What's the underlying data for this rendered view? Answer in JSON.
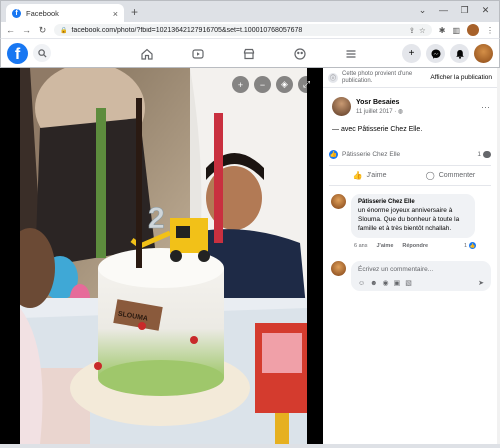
{
  "browser": {
    "tab_title": "Facebook",
    "tab_close": "×",
    "new_tab": "+",
    "favicon_letter": "f",
    "url": "facebook.com/photo/?fbid=10213642127916705&set=t.100010768057678",
    "window_controls": [
      "⌄",
      "—",
      "❐",
      "✕"
    ]
  },
  "fb_header": {
    "logo_letter": "f",
    "nav_icons": [
      "home-icon",
      "watch-icon",
      "marketplace-icon",
      "groups-icon",
      "menu-icon"
    ]
  },
  "notice": {
    "text": "Cette photo provient d'une publication.",
    "button_label": "Afficher la publication"
  },
  "post": {
    "author": "Yosr Besaies",
    "date": "11 juillet 2017 · ",
    "with_text": "— avec Pâtisserie Chez Elle."
  },
  "reactions": {
    "name": "Pâtisserie Chez Elle",
    "count": "1"
  },
  "actions": {
    "like_label": "J'aime",
    "comment_label": "Commenter"
  },
  "comment": {
    "author": "Pâtisserie Chez Elle",
    "text": "un énorme joyeux anniversaire à Slouma. Que du bonheur à toute la famille et à très bientôt nchallah.",
    "age": "6 ans",
    "like_label": "J'aime",
    "reply_label": "Répondre",
    "likes": "1"
  },
  "write": {
    "placeholder": "Écrivez un commentaire..."
  },
  "photo": {
    "cake_text": "SLOUMA",
    "candle_number": "2"
  },
  "colors": {
    "facebook_blue": "#1877f2",
    "panel_bg": "#ffffff",
    "photo_bg": "#000000"
  }
}
